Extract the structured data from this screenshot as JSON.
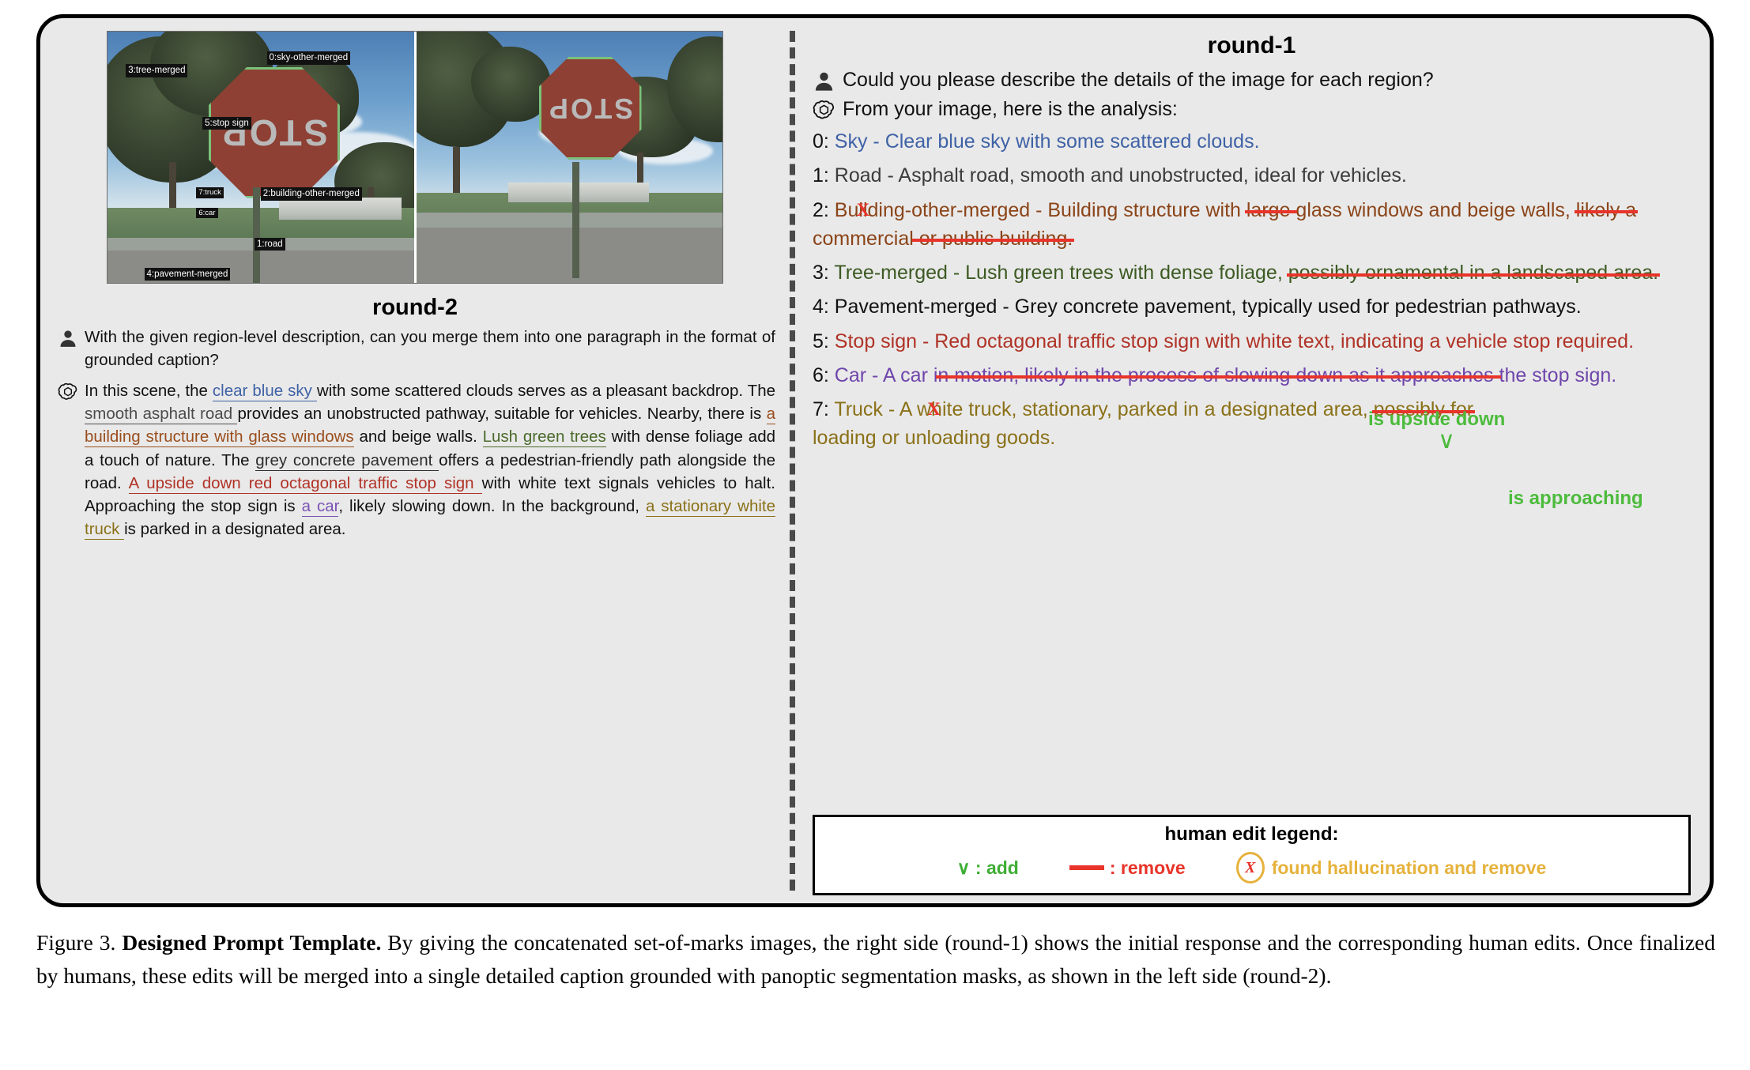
{
  "left": {
    "som_labels_a": [
      {
        "text": "3:tree-merged"
      },
      {
        "text": "0:sky-other-merged"
      },
      {
        "text": "5:stop sign"
      },
      {
        "text": "7:truck"
      },
      {
        "text": "6:car"
      },
      {
        "text": "2:building-other-merged"
      },
      {
        "text": "1:road"
      },
      {
        "text": "4:pavement-merged"
      }
    ],
    "sign_text": "STOP",
    "round2_title": "round-2",
    "user_prompt": "With the given region-level description, can you merge them into one paragraph in the format of grounded caption?",
    "caption_parts": [
      {
        "t": "In this scene, the ",
        "c": "",
        "u": false
      },
      {
        "t": "clear blue sky ",
        "c": "c-sky",
        "u": true
      },
      {
        "t": "with some scattered clouds serves as a pleasant backdrop. The ",
        "c": "",
        "u": false
      },
      {
        "t": "smooth asphalt road ",
        "c": "c-road",
        "u": true
      },
      {
        "t": "provides an unobstructed pathway, suitable for vehicles. Nearby, there is ",
        "c": "",
        "u": false
      },
      {
        "t": "a building structure with glass windows",
        "c": "c-bldg",
        "u": true
      },
      {
        "t": " and beige walls. ",
        "c": "",
        "u": false
      },
      {
        "t": "Lush green trees",
        "c": "c-tree",
        "u": true
      },
      {
        "t": " with dense foliage add a touch of nature. The ",
        "c": "",
        "u": false
      },
      {
        "t": "grey concrete pavement ",
        "c": "c-pave",
        "u": true
      },
      {
        "t": "offers a pedestrian-friendly path alongside the road. ",
        "c": "",
        "u": false
      },
      {
        "t": "A upside down red octagonal traffic stop sign ",
        "c": "c-stop",
        "u": true
      },
      {
        "t": "with white text signals vehicles to halt. Approaching the stop sign is ",
        "c": "",
        "u": false
      },
      {
        "t": "a car",
        "c": "c-car",
        "u": true
      },
      {
        "t": ", likely slowing down. In the background, ",
        "c": "",
        "u": false
      },
      {
        "t": "a stationary white truck ",
        "c": "c-truck",
        "u": true
      },
      {
        "t": "is parked in a designated area.",
        "c": "",
        "u": false
      }
    ]
  },
  "right": {
    "round1_title": "round-1",
    "user_prompt": "Could you please describe the details of the image for each region?",
    "assistant_intro": "From your image, here is the analysis:",
    "items": [
      {
        "index": "0:",
        "color": "i0",
        "segments": [
          {
            "t": " Sky - Clear blue sky with some scattered clouds.",
            "s": false
          }
        ]
      },
      {
        "index": "1:",
        "color": "i1",
        "segments": [
          {
            "t": " Road - Asphalt road, smooth and unobstructed, ideal for vehicles.",
            "s": false
          }
        ]
      },
      {
        "index": "2:",
        "color": "i2",
        "segments": [
          {
            "t": " Building-other-merged - Building structure with ",
            "s": false
          },
          {
            "t": "large ",
            "s": true
          },
          {
            "t": "glass windows and beige walls, ",
            "s": false
          },
          {
            "t": "likely a ",
            "s": true
          },
          {
            "t": "commercial",
            "s": false,
            "e": true
          },
          {
            "t": " or public building.",
            "s": true
          }
        ]
      },
      {
        "index": "3:",
        "color": "i3",
        "segments": [
          {
            "t": " Tree-merged - Lush green trees with dense foliage, ",
            "s": false
          },
          {
            "t": "possibly ornamental in a landscaped area.",
            "s": true
          }
        ]
      },
      {
        "index": "4:",
        "color": "i4",
        "segments": [
          {
            "t": " Pavement-merged - Grey concrete pavement, typically used for pedestrian pathways.",
            "s": false
          }
        ]
      },
      {
        "index": "5:",
        "color": "i5",
        "segments": [
          {
            "t": " Stop sign - Red octagonal traffic stop sign with white text, indicating a vehicle stop required.",
            "s": false
          }
        ]
      },
      {
        "index": "6:",
        "color": "i6",
        "segments": [
          {
            "t": " Car - A car i",
            "s": false
          },
          {
            "t": "n motion, likely in the process of slowing down as it approaches ",
            "s": true
          },
          {
            "t": "the stop sign.",
            "s": false
          }
        ]
      },
      {
        "index": "7:",
        "color": "i7",
        "segments": [
          {
            "t": " Truck - A white truck, stationary, parked in a designated area, ",
            "s": false
          },
          {
            "t": "possibly for ",
            "s": true
          },
          {
            "t": "loading or unloading goods.",
            "s": false,
            "e": true
          }
        ]
      }
    ],
    "additions": [
      {
        "text": "is upside down"
      },
      {
        "text": "is approaching"
      }
    ],
    "legend": {
      "title": "human edit legend:",
      "add": "∨ : add",
      "remove": ": remove",
      "hallucination": "found hallucination and remove",
      "x_glyph": "X"
    }
  },
  "caption": {
    "label": "Figure 3.",
    "bold_title": "Designed Prompt Template.",
    "text": " By giving the concatenated set-of-marks images, the right side (round-1) shows the initial response and the corresponding human edits.  Once finalized by humans, these edits will be merged into a single detailed caption grounded with panoptic segmentation masks, as shown in the left side (round-2)."
  },
  "colors": {
    "add_green": "#4cbb3c",
    "remove_red": "#e8342a",
    "hallucination_yellow": "#eeb93c"
  }
}
